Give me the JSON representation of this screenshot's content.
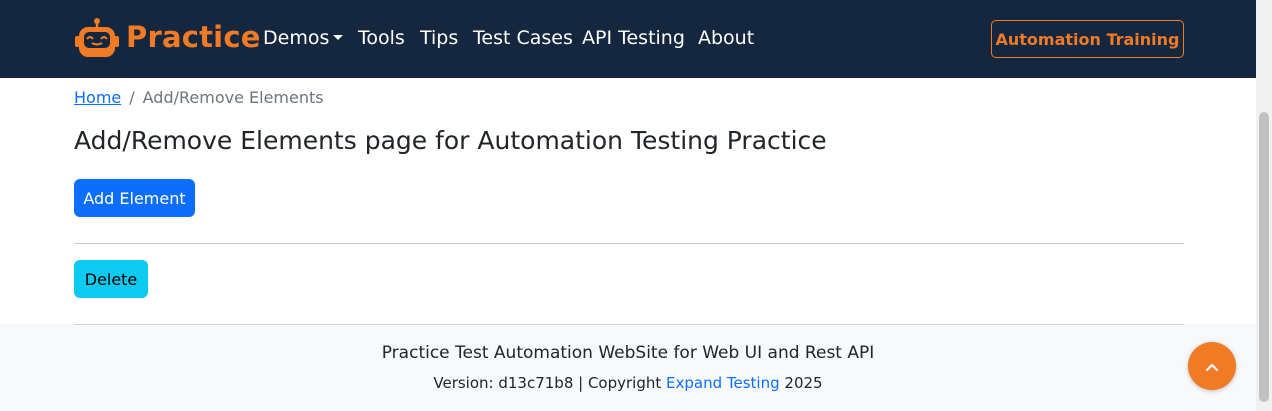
{
  "navbar": {
    "brand": "Practice",
    "items": [
      {
        "label": "Demos",
        "has_dropdown": true
      },
      {
        "label": "Tools"
      },
      {
        "label": "Tips"
      },
      {
        "label": "Test Cases"
      },
      {
        "label": "API Testing"
      },
      {
        "label": "About"
      }
    ],
    "cta_label": "Automation Training"
  },
  "breadcrumb": {
    "home": "Home",
    "separator": "/",
    "current": "Add/Remove Elements"
  },
  "main": {
    "title": "Add/Remove Elements page for Automation Testing Practice",
    "add_button": "Add Element",
    "delete_button": "Delete"
  },
  "footer": {
    "title": "Practice Test Automation WebSite for Web UI and Rest API",
    "version_prefix": "Version: d13c71b8 | Copyright",
    "link_label": "Expand Testing",
    "year": "2025"
  },
  "icons": {
    "logo": "robot-logo-icon",
    "scroll_top": "chevron-up-icon"
  },
  "colors": {
    "navbar_bg": "#15263f",
    "accent": "#f07b24",
    "primary": "#0d6efd",
    "info": "#0dcaf0"
  }
}
